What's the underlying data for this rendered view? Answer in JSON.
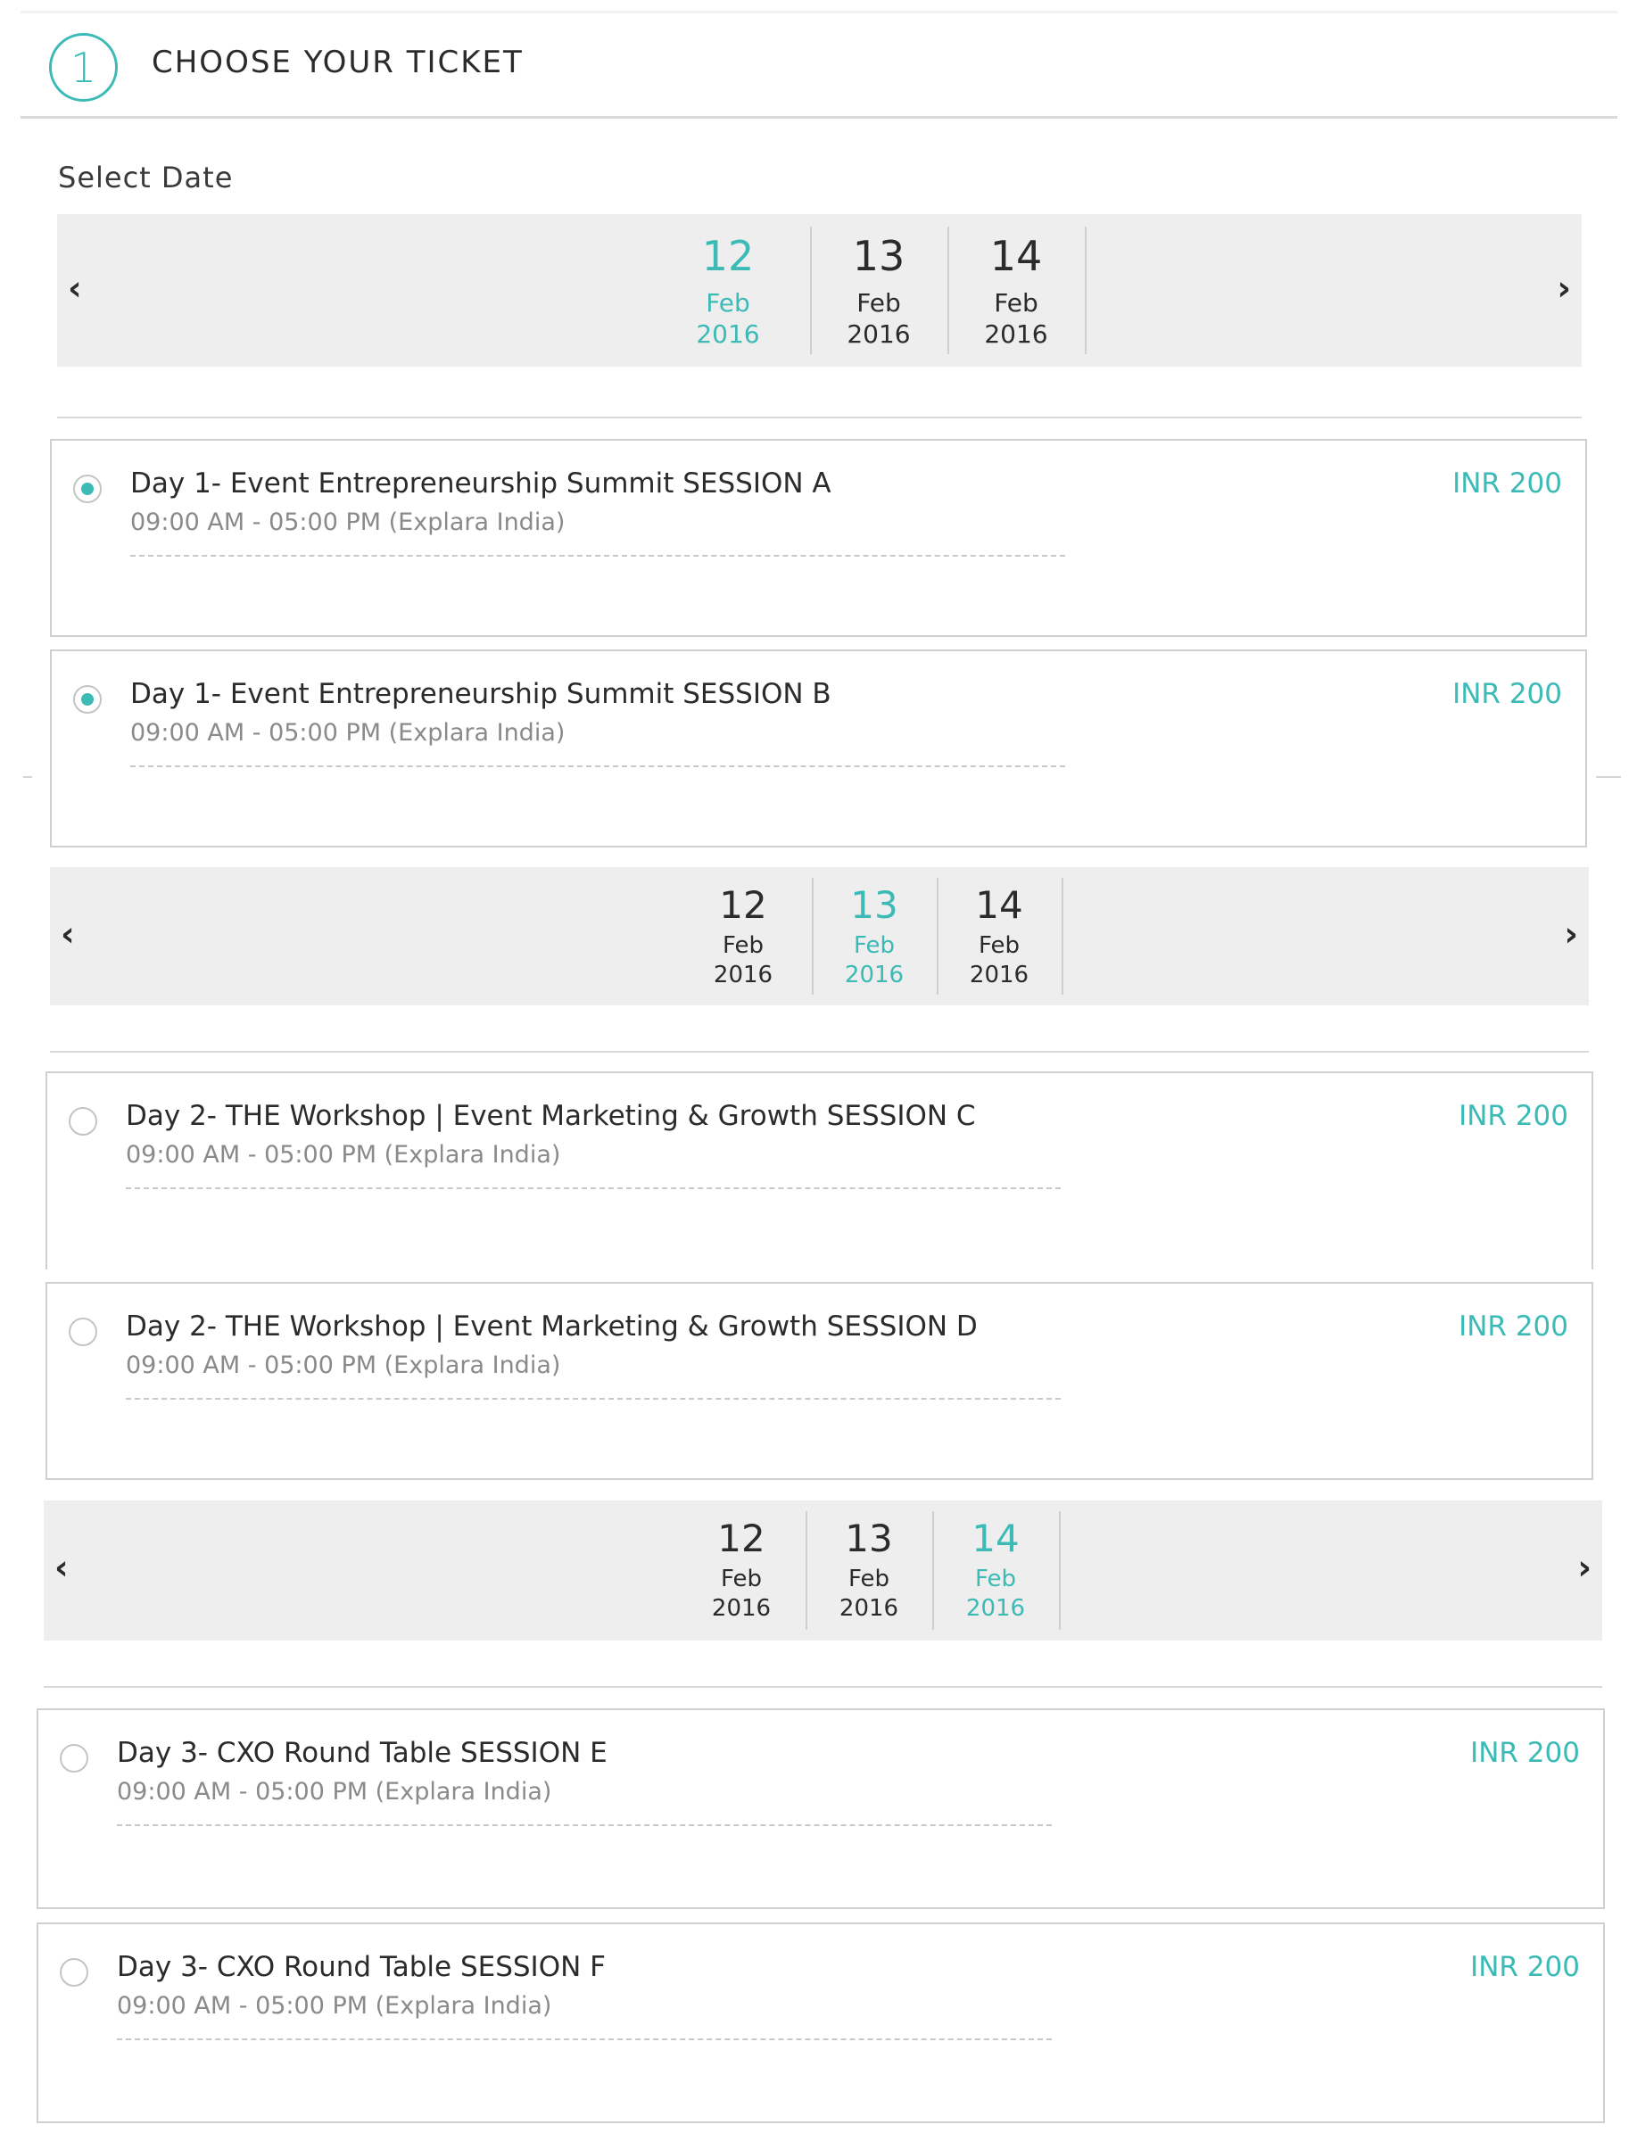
{
  "step": {
    "number": "1",
    "title": "CHOOSE YOUR TICKET"
  },
  "select_label": "Select Date",
  "colors": {
    "accent": "#3bbab6",
    "bar": "#eeeeee",
    "border": "#cfcfcf",
    "text": "#2b2b2b",
    "muted": "#8a8a8a"
  },
  "icons": {
    "prev": "chevron-left-icon",
    "next": "chevron-right-icon"
  },
  "nav": {
    "prev": "‹",
    "next": "›"
  },
  "date_bars": [
    {
      "selected": "12",
      "dates": [
        {
          "day": "12",
          "month": "Feb",
          "year": "2016"
        },
        {
          "day": "13",
          "month": "Feb",
          "year": "2016"
        },
        {
          "day": "14",
          "month": "Feb",
          "year": "2016"
        }
      ]
    },
    {
      "selected": "13",
      "dates": [
        {
          "day": "12",
          "month": "Feb",
          "year": "2016"
        },
        {
          "day": "13",
          "month": "Feb",
          "year": "2016"
        },
        {
          "day": "14",
          "month": "Feb",
          "year": "2016"
        }
      ]
    },
    {
      "selected": "14",
      "dates": [
        {
          "day": "12",
          "month": "Feb",
          "year": "2016"
        },
        {
          "day": "13",
          "month": "Feb",
          "year": "2016"
        },
        {
          "day": "14",
          "month": "Feb",
          "year": "2016"
        }
      ]
    }
  ],
  "tickets": [
    {
      "title": "Day 1- Event Entrepreneurship Summit  SESSION A",
      "time": "09:00 AM - 05:00 PM (Explara India)",
      "price": "INR 200",
      "selected": true
    },
    {
      "title": "Day 1- Event Entrepreneurship Summit  SESSION B",
      "time": "09:00 AM - 05:00 PM (Explara India)",
      "price": "INR 200",
      "selected": true
    },
    {
      "title": "Day 2- THE Workshop | Event Marketing & Growth SESSION C",
      "time": "09:00 AM - 05:00 PM (Explara India)",
      "price": "INR 200",
      "selected": false
    },
    {
      "title": "Day 2- THE Workshop | Event Marketing & Growth SESSION D",
      "time": "09:00 AM - 05:00 PM (Explara India)",
      "price": "INR 200",
      "selected": false
    },
    {
      "title": "Day 3- CXO Round Table  SESSION E",
      "time": "09:00 AM - 05:00 PM (Explara India)",
      "price": "INR 200",
      "selected": false
    },
    {
      "title": "Day 3- CXO Round Table  SESSION F",
      "time": "09:00 AM - 05:00 PM (Explara India)",
      "price": "INR 200",
      "selected": false
    }
  ]
}
